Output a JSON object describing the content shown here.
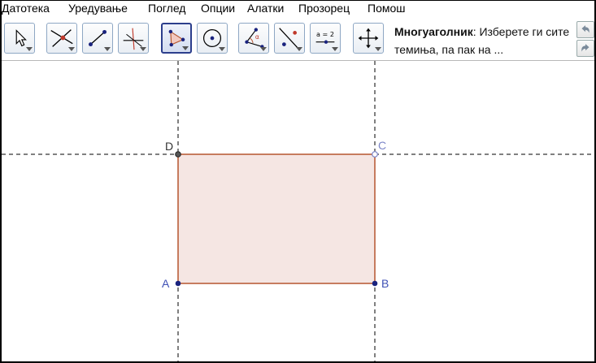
{
  "menubar": {
    "items": [
      "Датотека",
      "Уредување",
      "Поглед",
      "Опции",
      "Алатки",
      "Прозорец",
      "Помош"
    ]
  },
  "toolbar": {
    "tools": [
      {
        "icon": "arrow-pointer-icon",
        "name": "move-tool"
      },
      {
        "icon": "intersect-point-icon",
        "name": "point-tool"
      },
      {
        "icon": "segment-icon",
        "name": "line-tool"
      },
      {
        "icon": "perpendicular-line-icon",
        "name": "perpendicular-tool"
      },
      {
        "icon": "polygon-icon",
        "name": "polygon-tool",
        "active": true
      },
      {
        "icon": "circle-center-icon",
        "name": "circle-tool"
      },
      {
        "icon": "angle-icon",
        "name": "angle-tool"
      },
      {
        "icon": "reflect-point-icon",
        "name": "reflect-tool"
      },
      {
        "icon": "slider-icon",
        "name": "slider-tool",
        "text": "a = 2"
      },
      {
        "icon": "move-view-icon",
        "name": "move-view-tool"
      }
    ],
    "help_title": "Многуаголник",
    "help_text": ": Изберете ги сите темиња, па пак на ...",
    "undo_icon": "undo-icon",
    "redo_icon": "redo-icon"
  },
  "canvas": {
    "points": {
      "A": "A",
      "B": "B",
      "C": "C",
      "D": "D"
    },
    "polygon_fill": "#f5e6e3",
    "polygon_stroke": "#b5552e",
    "point_color": "#1a237e",
    "label_color": "#3f51b5",
    "label_color_light": "#7c86c8"
  }
}
